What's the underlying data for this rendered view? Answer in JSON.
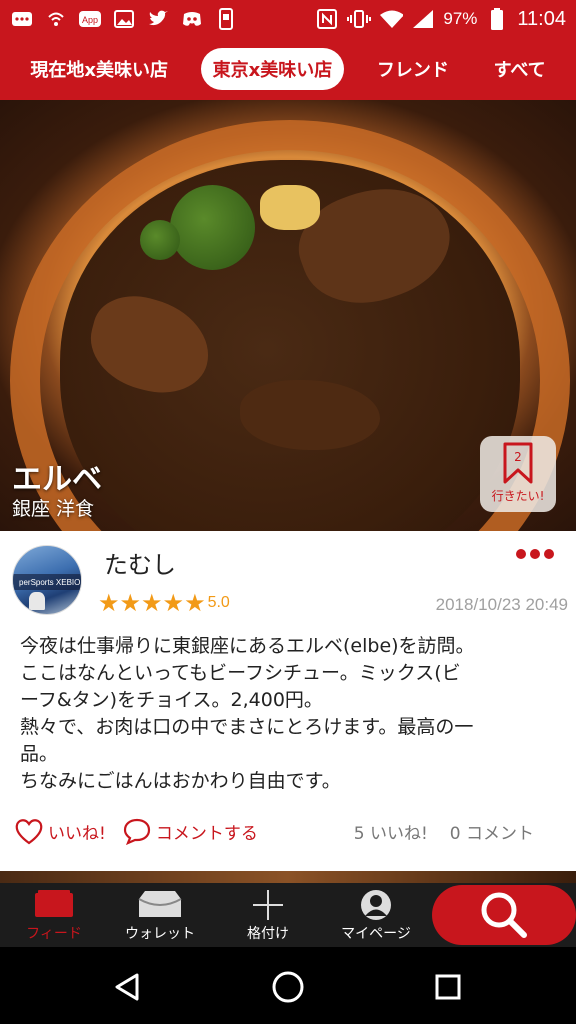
{
  "status_bar": {
    "left_icons": [
      "notification-icon",
      "wifi-call-icon",
      "app-icon",
      "image-icon",
      "twitter-icon",
      "discord-icon",
      "phone-icon"
    ],
    "right_icons": [
      "nfc-icon",
      "vibrate-icon",
      "wifi-icon",
      "signal-icon",
      "battery-icon"
    ],
    "battery": "97%",
    "time": "11:04"
  },
  "tabs": [
    {
      "label": "現在地x美味い店",
      "active": false
    },
    {
      "label": "東京x美味い店",
      "active": true
    },
    {
      "label": "フレンド",
      "active": false
    },
    {
      "label": "すべて",
      "active": false
    }
  ],
  "hero": {
    "restaurant_name": "エルベ",
    "area_genre": "銀座 洋食",
    "wish_count": "2",
    "wish_label": "行きたい!"
  },
  "post": {
    "username": "たむし",
    "avatar_text": "perSports XEBIO",
    "rating": "5.0",
    "stars": 5,
    "date": "2018/10/23 20:49",
    "body_lines": [
      "今夜は仕事帰りに東銀座にあるエルベ(elbe)を訪問。",
      "ここはなんといってもビーフシチュー。ミックス(ビ",
      "ーフ&タン)をチョイス。2,400円。",
      "熱々で、お肉は口の中でまさにとろけます。最高の一",
      "品。",
      "ちなみにごはんはおかわり自由です。"
    ],
    "like_label": "いいね!",
    "comment_label": "コメントする",
    "like_count": "5 いいね!",
    "comment_count": "0 コメント"
  },
  "bottom_nav": {
    "items": [
      {
        "label": "フィード",
        "icon": "feed-icon",
        "active": true
      },
      {
        "label": "ウォレット",
        "icon": "wallet-icon",
        "active": false
      },
      {
        "label": "格付け",
        "icon": "plus-icon",
        "active": false
      },
      {
        "label": "マイページ",
        "icon": "profile-icon",
        "active": false
      }
    ],
    "search_icon": "search-icon"
  },
  "system_nav": {
    "buttons": [
      "back-icon",
      "home-icon",
      "recents-icon"
    ]
  },
  "colors": {
    "brand": "#c8161d",
    "star": "#f29a17",
    "nav_bg": "#1c1c1c"
  }
}
